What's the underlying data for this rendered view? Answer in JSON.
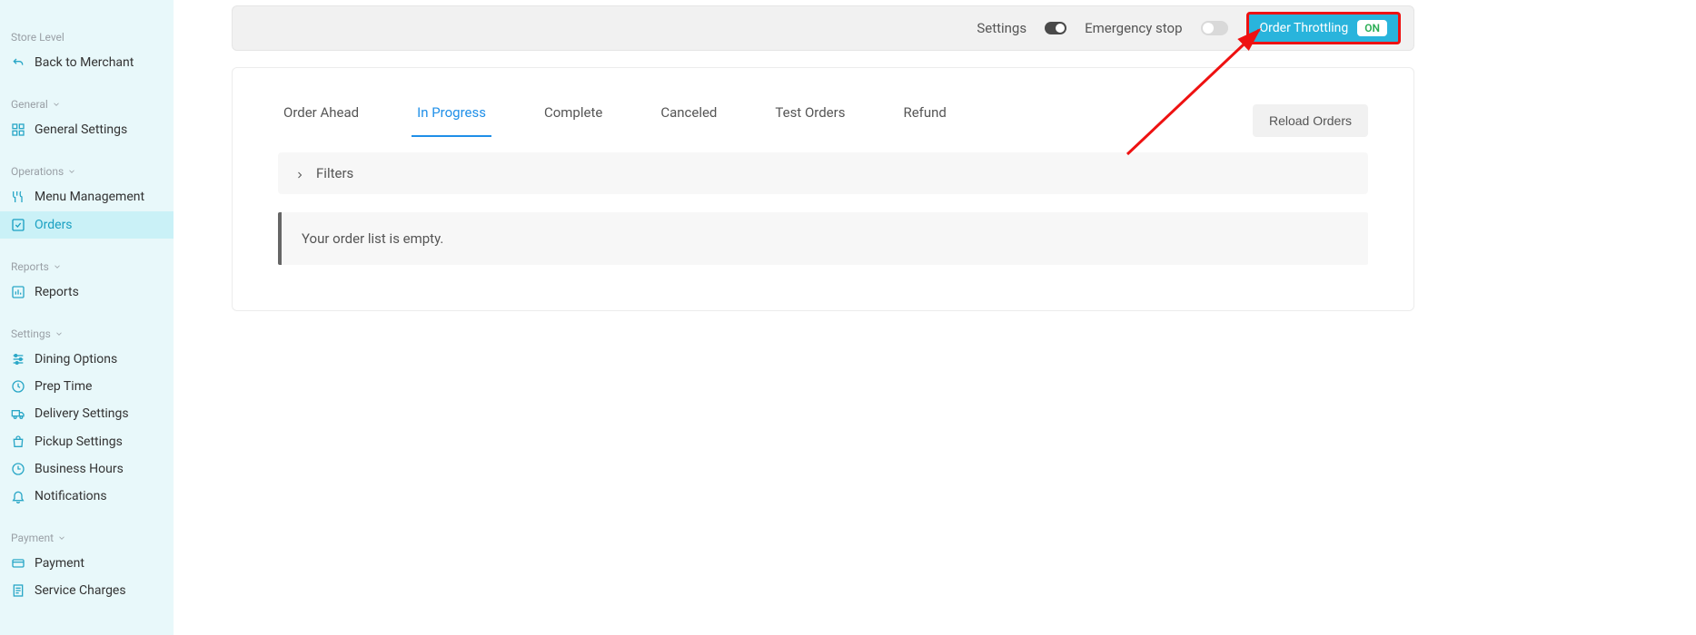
{
  "sidebar": {
    "store_level_label": "Store Level",
    "back_label": "Back to Merchant",
    "sections": {
      "general": {
        "title": "General",
        "items": [
          {
            "label": "General Settings",
            "icon": "grid-icon"
          }
        ]
      },
      "operations": {
        "title": "Operations",
        "items": [
          {
            "label": "Menu Management",
            "icon": "utensils-icon"
          },
          {
            "label": "Orders",
            "icon": "check-square-icon",
            "active": true
          }
        ]
      },
      "reports": {
        "title": "Reports",
        "items": [
          {
            "label": "Reports",
            "icon": "bar-chart-icon"
          }
        ]
      },
      "settings": {
        "title": "Settings",
        "items": [
          {
            "label": "Dining Options",
            "icon": "sliders-icon"
          },
          {
            "label": "Prep Time",
            "icon": "clock-icon"
          },
          {
            "label": "Delivery Settings",
            "icon": "truck-icon"
          },
          {
            "label": "Pickup Settings",
            "icon": "bag-icon"
          },
          {
            "label": "Business Hours",
            "icon": "hours-icon"
          },
          {
            "label": "Notifications",
            "icon": "bell-icon"
          }
        ]
      },
      "payment": {
        "title": "Payment",
        "items": [
          {
            "label": "Payment",
            "icon": "card-icon"
          },
          {
            "label": "Service Charges",
            "icon": "receipt-icon"
          }
        ]
      }
    }
  },
  "topbar": {
    "settings_label": "Settings",
    "emergency_label": "Emergency stop",
    "throttle_label": "Order Throttling",
    "throttle_state": "ON"
  },
  "tabs": [
    {
      "label": "Order Ahead"
    },
    {
      "label": "In Progress",
      "active": true
    },
    {
      "label": "Complete"
    },
    {
      "label": "Canceled"
    },
    {
      "label": "Test Orders"
    },
    {
      "label": "Refund"
    }
  ],
  "reload_label": "Reload Orders",
  "filters_label": "Filters",
  "empty_message": "Your order list is empty."
}
